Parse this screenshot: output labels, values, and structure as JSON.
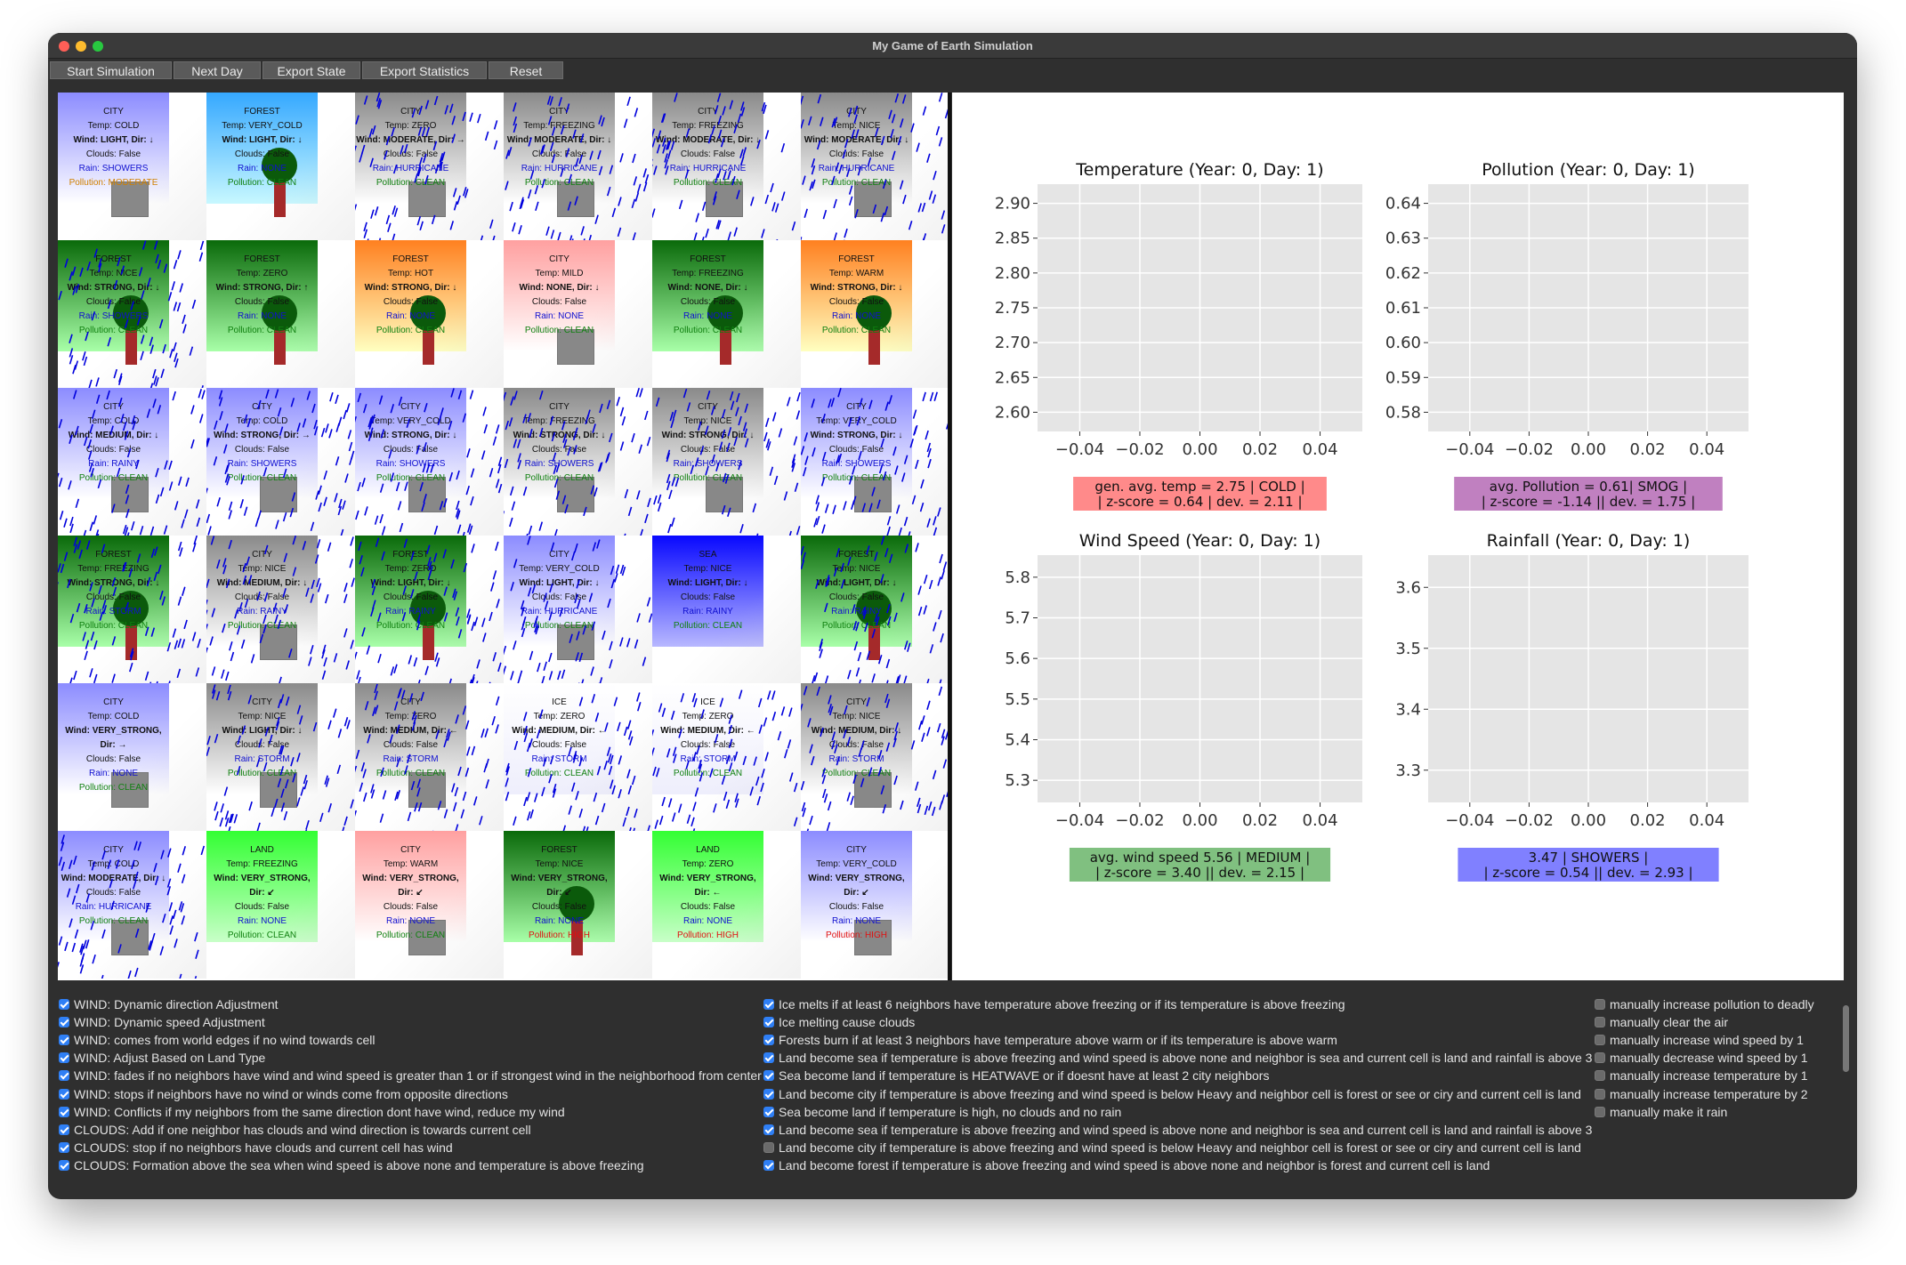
{
  "window": {
    "title": "My Game of Earth Simulation"
  },
  "toolbar": {
    "buttons": [
      "Start Simulation",
      "Next Day",
      "Export State",
      "Export Statistics",
      "Reset"
    ]
  },
  "colors": {
    "city_blue": "#9c9cff",
    "forest_green": "#1a7a1a",
    "forest_hot": "#ff8c20",
    "city_mild": "#ffb0b0",
    "sea": "#1010ff",
    "land": "#33ff33",
    "ice": "#ffffff",
    "gray": "#9a9a9a"
  },
  "grid": [
    [
      {
        "type": "CITY",
        "temp": "COLD",
        "wind": "LIGHT",
        "dir": "↓",
        "clouds": "False",
        "rain": "SHOWERS",
        "pollution": "MODERATE",
        "bg": "blue",
        "rainy": false
      },
      {
        "type": "FOREST",
        "temp": "VERY_COLD",
        "wind": "LIGHT",
        "dir": "↓",
        "clouds": "False",
        "rain": "NONE",
        "pollution": "CLEAN",
        "bg": "lightblue",
        "rainy": false
      },
      {
        "type": "CITY",
        "temp": "ZERO",
        "wind": "MODERATE",
        "dir": "→",
        "clouds": "False",
        "rain": "HURRICANE",
        "pollution": "CLEAN",
        "bg": "gray",
        "rainy": true
      },
      {
        "type": "CITY",
        "temp": "FREEZING",
        "wind": "MODERATE",
        "dir": "↓",
        "clouds": "False",
        "rain": "HURRICANE",
        "pollution": "CLEAN",
        "bg": "gray",
        "rainy": true
      },
      {
        "type": "CITY",
        "temp": "FREEZING",
        "wind": "MODERATE",
        "dir": "↓",
        "clouds": "False",
        "rain": "HURRICANE",
        "pollution": "CLEAN",
        "bg": "gray",
        "rainy": true
      },
      {
        "type": "CITY",
        "temp": "NICE",
        "wind": "MODERATE",
        "dir": "↓",
        "clouds": "False",
        "rain": "HURRICANE",
        "pollution": "CLEAN",
        "bg": "gray",
        "rainy": true
      }
    ],
    [
      {
        "type": "FOREST",
        "temp": "NICE",
        "wind": "STRONG",
        "dir": "↓",
        "clouds": "False",
        "rain": "SHOWERS",
        "pollution": "CLEAN",
        "bg": "green",
        "rainy": true
      },
      {
        "type": "FOREST",
        "temp": "ZERO",
        "wind": "STRONG",
        "dir": "↑",
        "clouds": "False",
        "rain": "NONE",
        "pollution": "CLEAN",
        "bg": "green",
        "rainy": false
      },
      {
        "type": "FOREST",
        "temp": "HOT",
        "wind": "STRONG",
        "dir": "↓",
        "clouds": "False",
        "rain": "NONE",
        "pollution": "CLEAN",
        "bg": "hot",
        "rainy": false
      },
      {
        "type": "CITY",
        "temp": "MILD",
        "wind": "NONE",
        "dir": "↓",
        "clouds": "False",
        "rain": "NONE",
        "pollution": "CLEAN",
        "bg": "mild",
        "rainy": false
      },
      {
        "type": "FOREST",
        "temp": "FREEZING",
        "wind": "NONE",
        "dir": "↓",
        "clouds": "False",
        "rain": "NONE",
        "pollution": "CLEAN",
        "bg": "green",
        "rainy": false
      },
      {
        "type": "FOREST",
        "temp": "WARM",
        "wind": "STRONG",
        "dir": "↓",
        "clouds": "False",
        "rain": "NONE",
        "pollution": "CLEAN",
        "bg": "hot",
        "rainy": false
      }
    ],
    [
      {
        "type": "CITY",
        "temp": "COLD",
        "wind": "MEDIUM",
        "dir": "↓",
        "clouds": "False",
        "rain": "RAINY",
        "pollution": "CLEAN",
        "bg": "blue",
        "rainy": true
      },
      {
        "type": "CITY",
        "temp": "COLD",
        "wind": "STRONG",
        "dir": "→",
        "clouds": "False",
        "rain": "SHOWERS",
        "pollution": "CLEAN",
        "bg": "blue",
        "rainy": true
      },
      {
        "type": "CITY",
        "temp": "VERY_COLD",
        "wind": "STRONG",
        "dir": "↓",
        "clouds": "False",
        "rain": "SHOWERS",
        "pollution": "CLEAN",
        "bg": "blue",
        "rainy": true
      },
      {
        "type": "CITY",
        "temp": "FREEZING",
        "wind": "STRONG",
        "dir": "↓",
        "clouds": "False",
        "rain": "SHOWERS",
        "pollution": "CLEAN",
        "bg": "gray",
        "rainy": true
      },
      {
        "type": "CITY",
        "temp": "NICE",
        "wind": "STRONG",
        "dir": "↓",
        "clouds": "False",
        "rain": "SHOWERS",
        "pollution": "CLEAN",
        "bg": "gray",
        "rainy": true
      },
      {
        "type": "CITY",
        "temp": "VERY_COLD",
        "wind": "STRONG",
        "dir": "↓",
        "clouds": "False",
        "rain": "SHOWERS",
        "pollution": "CLEAN",
        "bg": "blue",
        "rainy": true
      }
    ],
    [
      {
        "type": "FOREST",
        "temp": "FREEZING",
        "wind": "STRONG",
        "dir": "↓",
        "clouds": "False",
        "rain": "STORM",
        "pollution": "CLEAN",
        "bg": "green",
        "rainy": true
      },
      {
        "type": "CITY",
        "temp": "NICE",
        "wind": "MEDIUM",
        "dir": "↓",
        "clouds": "False",
        "rain": "RAINY",
        "pollution": "CLEAN",
        "bg": "gray",
        "rainy": true
      },
      {
        "type": "FOREST",
        "temp": "ZERO",
        "wind": "LIGHT",
        "dir": "↓",
        "clouds": "False",
        "rain": "RAINY",
        "pollution": "CLEAN",
        "bg": "green",
        "rainy": true
      },
      {
        "type": "CITY",
        "temp": "VERY_COLD",
        "wind": "LIGHT",
        "dir": "↓",
        "clouds": "False",
        "rain": "HURRICANE",
        "pollution": "CLEAN",
        "bg": "blue",
        "rainy": true
      },
      {
        "type": "SEA",
        "temp": "NICE",
        "wind": "LIGHT",
        "dir": "↓",
        "clouds": "False",
        "rain": "RAINY",
        "pollution": "CLEAN",
        "bg": "sea",
        "rainy": false
      },
      {
        "type": "FOREST",
        "temp": "NICE",
        "wind": "LIGHT",
        "dir": "↓",
        "clouds": "False",
        "rain": "RAINY",
        "pollution": "CLEAN",
        "bg": "green",
        "rainy": true
      }
    ],
    [
      {
        "type": "CITY",
        "temp": "COLD",
        "wind": "VERY_STRONG",
        "dir": "→",
        "clouds": "False",
        "rain": "NONE",
        "pollution": "CLEAN",
        "bg": "blue",
        "rainy": false
      },
      {
        "type": "CITY",
        "temp": "NICE",
        "wind": "LIGHT",
        "dir": "↓",
        "clouds": "False",
        "rain": "STORM",
        "pollution": "CLEAN",
        "bg": "gray",
        "rainy": true
      },
      {
        "type": "CITY",
        "temp": "ZERO",
        "wind": "MEDIUM",
        "dir": "←",
        "clouds": "False",
        "rain": "STORM",
        "pollution": "CLEAN",
        "bg": "gray",
        "rainy": true
      },
      {
        "type": "ICE",
        "temp": "ZERO",
        "wind": "MEDIUM",
        "dir": "←",
        "clouds": "False",
        "rain": "STORM",
        "pollution": "CLEAN",
        "bg": "ice",
        "rainy": true
      },
      {
        "type": "ICE",
        "temp": "ZERO",
        "wind": "MEDIUM",
        "dir": "←",
        "clouds": "False",
        "rain": "STORM",
        "pollution": "CLEAN",
        "bg": "ice",
        "rainy": true
      },
      {
        "type": "CITY",
        "temp": "NICE",
        "wind": "MEDIUM",
        "dir": "↓",
        "clouds": "False",
        "rain": "STORM",
        "pollution": "CLEAN",
        "bg": "gray",
        "rainy": true
      }
    ],
    [
      {
        "type": "CITY",
        "temp": "COLD",
        "wind": "MODERATE",
        "dir": "↓",
        "clouds": "False",
        "rain": "HURRICANE",
        "pollution": "CLEAN",
        "bg": "blue",
        "rainy": true
      },
      {
        "type": "LAND",
        "temp": "FREEZING",
        "wind": "VERY_STRONG",
        "dir": "↙",
        "clouds": "False",
        "rain": "NONE",
        "pollution": "CLEAN",
        "bg": "land",
        "rainy": false
      },
      {
        "type": "CITY",
        "temp": "WARM",
        "wind": "VERY_STRONG",
        "dir": "↙",
        "clouds": "False",
        "rain": "NONE",
        "pollution": "CLEAN",
        "bg": "mild",
        "rainy": false
      },
      {
        "type": "FOREST",
        "temp": "NICE",
        "wind": "VERY_STRONG",
        "dir": "↙",
        "clouds": "False",
        "rain": "NONE",
        "pollution": "HIGH",
        "bg": "green",
        "rainy": false
      },
      {
        "type": "LAND",
        "temp": "ZERO",
        "wind": "VERY_STRONG",
        "dir": "←",
        "clouds": "False",
        "rain": "NONE",
        "pollution": "HIGH",
        "bg": "land",
        "rainy": false
      },
      {
        "type": "CITY",
        "temp": "VERY_COLD",
        "wind": "VERY_STRONG",
        "dir": "↙",
        "clouds": "False",
        "rain": "NONE",
        "pollution": "HIGH",
        "bg": "blue",
        "rainy": false
      }
    ]
  ],
  "charts": [
    {
      "title": "Temperature (Year: 0, Day: 1)",
      "yticks": [
        "2.90",
        "2.85",
        "2.80",
        "2.75",
        "2.70",
        "2.65",
        "2.60"
      ],
      "xticks": [
        "−0.04",
        "−0.02",
        "0.00",
        "0.02",
        "0.04"
      ],
      "stat_line1": "gen. avg. temp = 2.75 | COLD |",
      "stat_line2": "| z-score = 0.64 | dev. = 2.11 |",
      "box_color": "#ff8a8a"
    },
    {
      "title": "Pollution (Year: 0, Day: 1)",
      "yticks": [
        "0.64",
        "0.63",
        "0.62",
        "0.61",
        "0.60",
        "0.59",
        "0.58"
      ],
      "xticks": [
        "−0.04",
        "−0.02",
        "0.00",
        "0.02",
        "0.04"
      ],
      "stat_line1": "avg. Pollution = 0.61| SMOG |",
      "stat_line2": "| z-score = -1.14 || dev. = 1.75 |",
      "box_color": "#c080c0"
    },
    {
      "title": "Wind Speed (Year: 0, Day: 1)",
      "yticks": [
        "5.8",
        "5.7",
        "5.6",
        "5.5",
        "5.4",
        "5.3"
      ],
      "xticks": [
        "−0.04",
        "−0.02",
        "0.00",
        "0.02",
        "0.04"
      ],
      "stat_line1": "avg. wind speed 5.56 | MEDIUM |",
      "stat_line2": "| z-score = 3.40 || dev. = 2.15 |",
      "box_color": "#80c080"
    },
    {
      "title": "Rainfall (Year: 0, Day: 1)",
      "yticks": [
        "3.6",
        "3.5",
        "3.4",
        "3.3"
      ],
      "xticks": [
        "−0.04",
        "−0.02",
        "0.00",
        "0.02",
        "0.04"
      ],
      "stat_line1": "3.47 | SHOWERS |",
      "stat_line2": "| z-score = 0.54 || dev. = 2.93 |",
      "box_color": "#8080ff"
    }
  ],
  "rules_col1": [
    {
      "label": "WIND: Dynamic direction Adjustment",
      "checked": true
    },
    {
      "label": "WIND: Dynamic speed Adjustment",
      "checked": true
    },
    {
      "label": "WIND: comes from world edges if no wind towards cell",
      "checked": true
    },
    {
      "label": "WIND: Adjust Based on Land Type",
      "checked": true
    },
    {
      "label": "WIND: fades if no neighbors have wind and wind speed is greater than 1 or if strongest wind in the neighborhood from center",
      "checked": true
    },
    {
      "label": "WIND: stops if neighbors have no wind or winds come from opposite directions",
      "checked": true
    },
    {
      "label": "WIND: Conflicts if my neighbors from the same direction dont have wind, reduce my wind",
      "checked": true
    },
    {
      "label": "CLOUDS: Add if one neighbor has clouds and wind direction is towards current cell",
      "checked": true
    },
    {
      "label": "CLOUDS: stop if no neighbors have clouds and current cell has wind",
      "checked": true
    },
    {
      "label": "CLOUDS: Formation above the sea when wind speed is above none and temperature is above freezing",
      "checked": true
    }
  ],
  "rules_col2": [
    {
      "label": "Ice melts if at least 6 neighbors have temperature above freezing or if its temperature is above freezing",
      "checked": true
    },
    {
      "label": "Ice melting cause clouds",
      "checked": true
    },
    {
      "label": "Forests burn if at least 3 neighbors have temperature above warm or if its temperature is above warm",
      "checked": true
    },
    {
      "label": "Land become sea if temperature is above freezing and wind speed is above none and neighbor is sea and current cell is land and rainfall is above 3",
      "checked": true
    },
    {
      "label": "Sea become land if temperature is HEATWAVE or if doesnt have at least 2 city neighbors",
      "checked": true
    },
    {
      "label": "Land become city if temperature is above freezing and wind speed is below Heavy and neighbor cell is forest or see or ciry and current cell is land",
      "checked": true
    },
    {
      "label": "Sea become land if temperature is high, no clouds and no rain",
      "checked": true
    },
    {
      "label": "Land become sea if temperature is above freezing and wind speed is above none and neighbor is sea and current cell is land and rainfall is above 3",
      "checked": true
    },
    {
      "label": "Land become city if temperature is above freezing and wind speed is below Heavy and neighbor cell is forest or see or ciry and current cell is land",
      "checked": false
    },
    {
      "label": "Land become forest if temperature is above freezing and wind speed is above none and neighbor is forest and current cell is land",
      "checked": true
    }
  ],
  "rules_col3": [
    {
      "label": "manually increase pollution to deadly",
      "checked": false
    },
    {
      "label": "manually clear the air",
      "checked": false
    },
    {
      "label": "manually increase wind speed by 1",
      "checked": false
    },
    {
      "label": "manually decrease wind speed by 1",
      "checked": false
    },
    {
      "label": "manually increase temperature by 1",
      "checked": false
    },
    {
      "label": "manually increase temperature by 2",
      "checked": false
    },
    {
      "label": "manually make it rain",
      "checked": false
    }
  ]
}
